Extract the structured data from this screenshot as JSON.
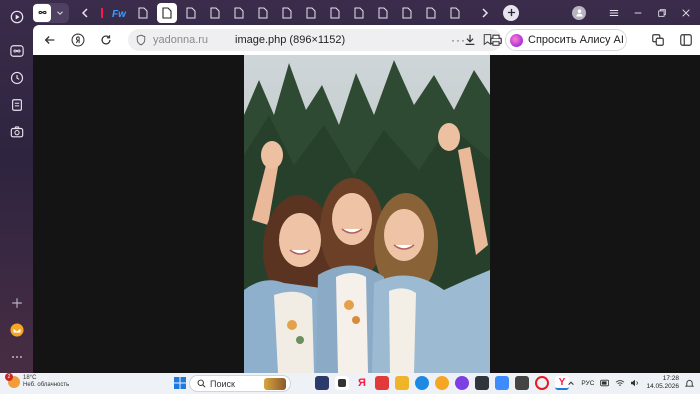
{
  "browser": {
    "address": {
      "domain": "yadonna.ru",
      "page_title": "image.php (896×1152)",
      "more_label": "···"
    },
    "alice_button_label": "Спросить Алису AI",
    "tab_count": 15,
    "accent": "#ff1744"
  },
  "image": {
    "semantic": "three-smiling-women-waving-forest"
  },
  "taskbar": {
    "weather": {
      "temp": "18°C",
      "desc": "Неб. облачность"
    },
    "search_placeholder": "Поиск",
    "lang": "РУС",
    "time": "17:28",
    "date": "14.05.2026",
    "notif_badge": "2"
  }
}
